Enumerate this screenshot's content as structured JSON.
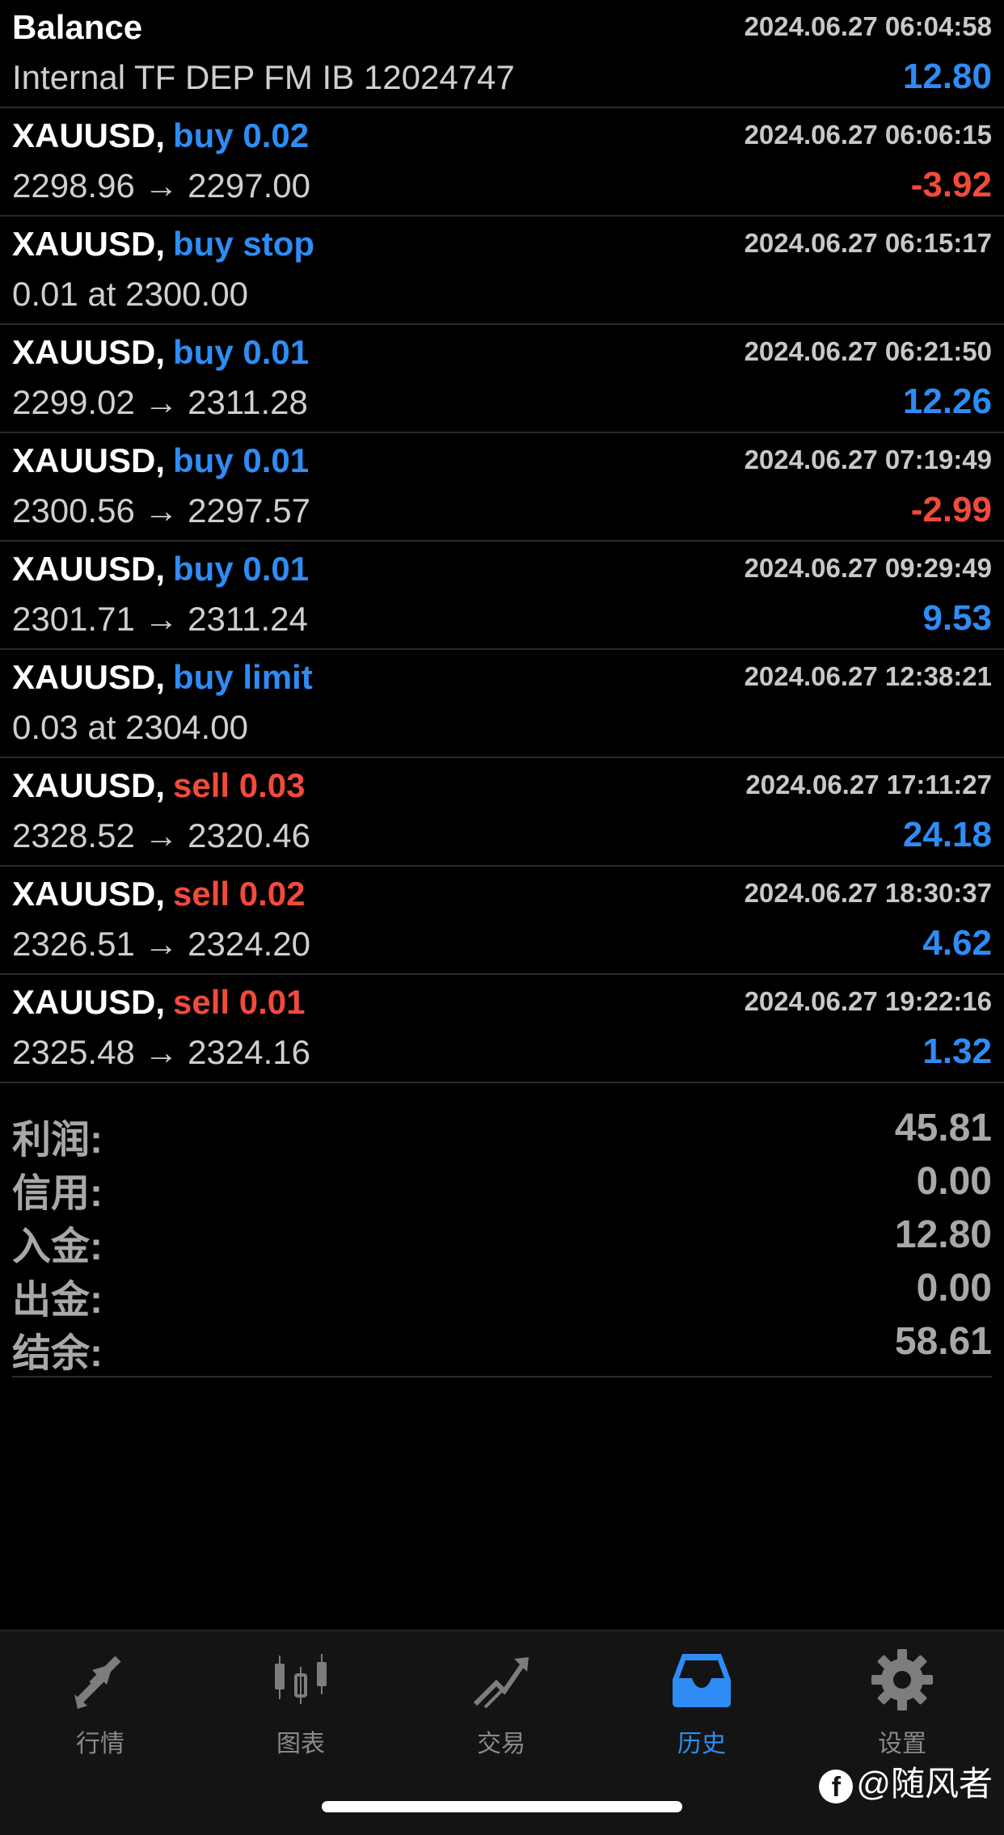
{
  "rows": [
    {
      "l1a": "Balance",
      "l1b": "",
      "type": "plain",
      "time": "2024.06.27 06:04:58",
      "l2": "Internal TF DEP FM IB 12024747",
      "pl": "12.80",
      "plType": "pos"
    },
    {
      "l1a": "XAUUSD,",
      "l1b": "buy 0.02",
      "type": "buy",
      "time": "2024.06.27 06:06:15",
      "l2": "2298.96 → 2297.00",
      "pl": "-3.92",
      "plType": "neg"
    },
    {
      "l1a": "XAUUSD,",
      "l1b": "buy stop",
      "type": "buy",
      "time": "2024.06.27 06:15:17",
      "l2": "0.01 at 2300.00",
      "pl": "",
      "plType": "pos"
    },
    {
      "l1a": "XAUUSD,",
      "l1b": "buy 0.01",
      "type": "buy",
      "time": "2024.06.27 06:21:50",
      "l2": "2299.02 → 2311.28",
      "pl": "12.26",
      "plType": "pos"
    },
    {
      "l1a": "XAUUSD,",
      "l1b": "buy 0.01",
      "type": "buy",
      "time": "2024.06.27 07:19:49",
      "l2": "2300.56 → 2297.57",
      "pl": "-2.99",
      "plType": "neg"
    },
    {
      "l1a": "XAUUSD,",
      "l1b": "buy 0.01",
      "type": "buy",
      "time": "2024.06.27 09:29:49",
      "l2": "2301.71 → 2311.24",
      "pl": "9.53",
      "plType": "pos"
    },
    {
      "l1a": "XAUUSD,",
      "l1b": "buy limit",
      "type": "buy",
      "time": "2024.06.27 12:38:21",
      "l2": "0.03 at 2304.00",
      "pl": "",
      "plType": "pos"
    },
    {
      "l1a": "XAUUSD,",
      "l1b": "sell 0.03",
      "type": "sell",
      "time": "2024.06.27 17:11:27",
      "l2": "2328.52 → 2320.46",
      "pl": "24.18",
      "plType": "pos"
    },
    {
      "l1a": "XAUUSD,",
      "l1b": "sell 0.02",
      "type": "sell",
      "time": "2024.06.27 18:30:37",
      "l2": "2326.51 → 2324.20",
      "pl": "4.62",
      "plType": "pos"
    },
    {
      "l1a": "XAUUSD,",
      "l1b": "sell 0.01",
      "type": "sell",
      "time": "2024.06.27 19:22:16",
      "l2": "2325.48 → 2324.16",
      "pl": "1.32",
      "plType": "pos"
    }
  ],
  "summary": [
    {
      "k": "利润:",
      "v": "45.81"
    },
    {
      "k": "信用:",
      "v": "0.00"
    },
    {
      "k": "入金:",
      "v": "12.80"
    },
    {
      "k": "出金:",
      "v": "0.00"
    },
    {
      "k": "结余:",
      "v": "58.61"
    }
  ],
  "tabs": [
    {
      "label": "行情",
      "icon": "quotes-arrows-icon",
      "active": false
    },
    {
      "label": "图表",
      "icon": "candlestick-chart-icon",
      "active": false
    },
    {
      "label": "交易",
      "icon": "trade-trend-icon",
      "active": false
    },
    {
      "label": "历史",
      "icon": "history-inbox-icon",
      "active": true
    },
    {
      "label": "设置",
      "icon": "gear-icon",
      "active": false
    }
  ],
  "watermark": {
    "fb": "f",
    "text": "@随风者"
  },
  "colors": {
    "blue": "#2f8cf4",
    "red": "#f24a3c",
    "bg": "#000000",
    "tabbar": "#141414"
  }
}
